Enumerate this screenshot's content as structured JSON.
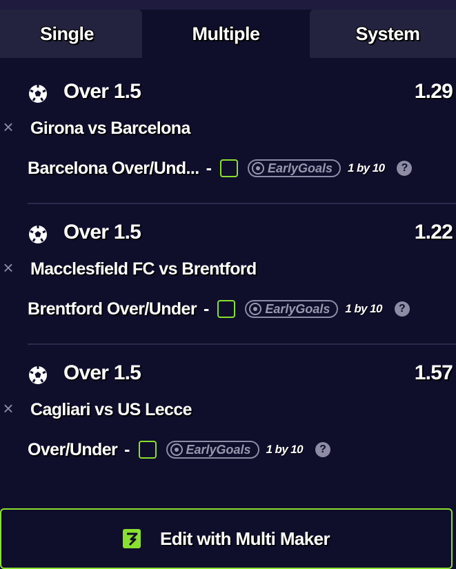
{
  "tabs": [
    {
      "label": "Single",
      "active": false
    },
    {
      "label": "Multiple",
      "active": true
    },
    {
      "label": "System",
      "active": false
    }
  ],
  "legs": [
    {
      "market": "Over 1.5",
      "odds": "1.29",
      "match": "Girona vs Barcelona",
      "bet": "Barcelona Over/Und...",
      "dash": "-",
      "early_goals": "EarlyGoals",
      "one_by": "1 by 10",
      "help": "?"
    },
    {
      "market": "Over 1.5",
      "odds": "1.22",
      "match": "Macclesfield FC vs Brentford",
      "bet": "Brentford Over/Under",
      "dash": "-",
      "early_goals": "EarlyGoals",
      "one_by": "1 by 10",
      "help": "?"
    },
    {
      "market": "Over 1.5",
      "odds": "1.57",
      "match": "Cagliari vs US Lecce",
      "bet": "Over/Under",
      "dash": "-",
      "early_goals": "EarlyGoals",
      "one_by": "1 by 10",
      "help": "?"
    }
  ],
  "remove_symbol": "×",
  "multi_maker": {
    "label": "Edit with Multi Maker"
  },
  "colors": {
    "background": "#0f0e2b",
    "accent": "#8ae02f",
    "tab": "#23233f",
    "muted": "#8d8ca4"
  }
}
